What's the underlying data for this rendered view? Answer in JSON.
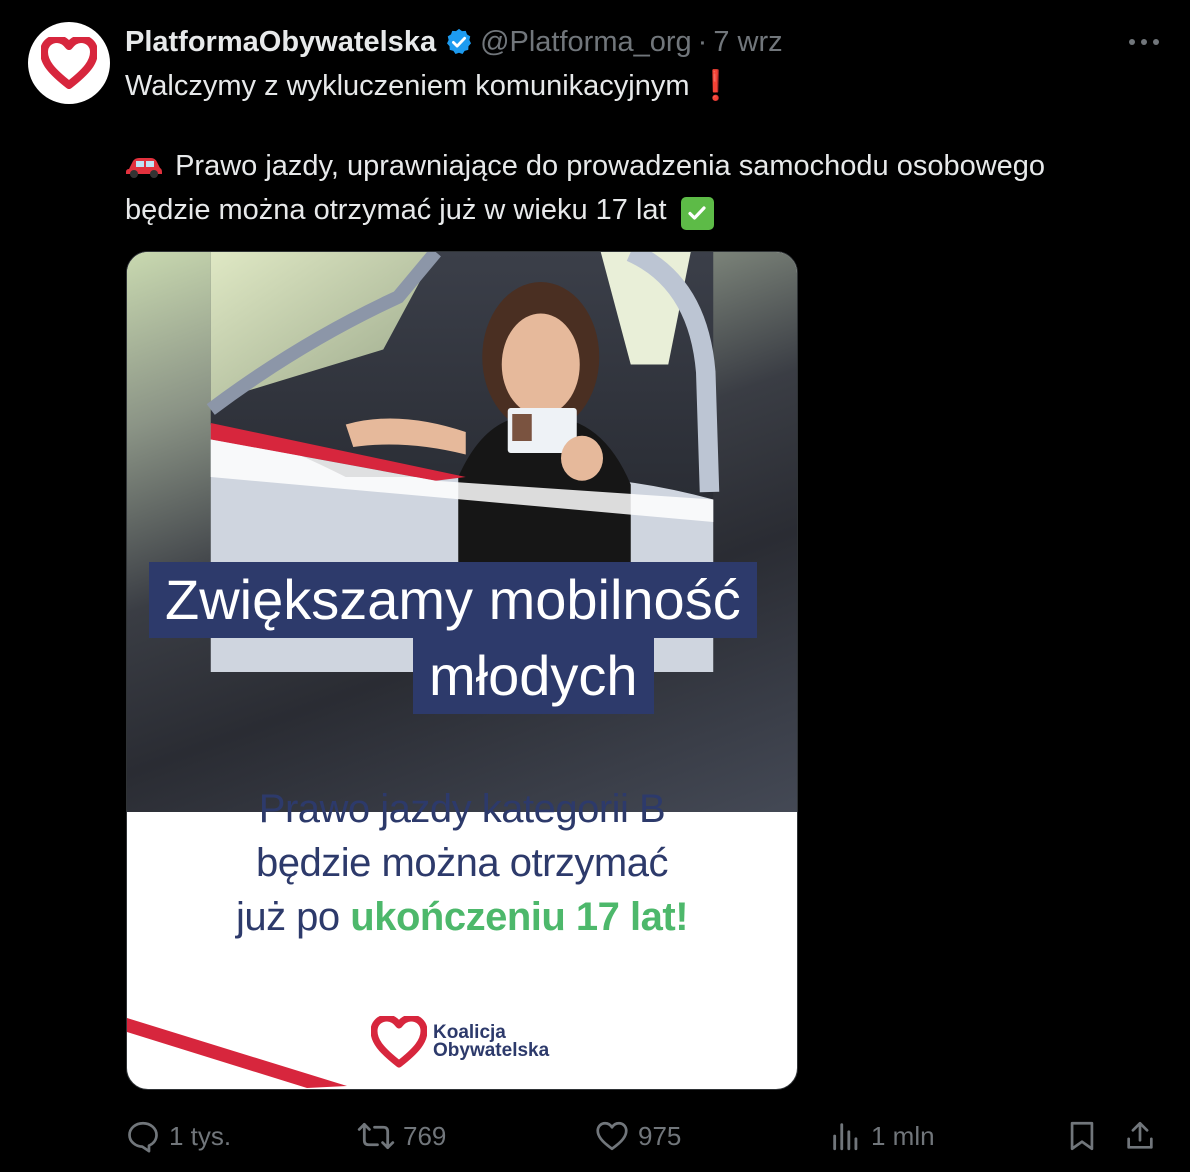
{
  "author": {
    "display_name": "PlatformaObywatelska",
    "handle": "@Platforma_org",
    "separator": "·",
    "date": "7 wrz",
    "avatar_icon": "heart-logo-icon",
    "verified_icon": "verified-badge-icon"
  },
  "more_icon": "more-horizontal-icon",
  "tweet": {
    "line1": "Walczymy z wykluczeniem komunikacyjnym",
    "line1_emoji": "❗",
    "line2_emoji": "🚗",
    "line2": "Prawo jazdy, uprawniające do prowadzenia samochodu osobowego",
    "line3": "będzie można otrzymać już w wieku 17 lat",
    "line3_emoji": "✅"
  },
  "media": {
    "headline_line1": "Zwiększamy mobilność",
    "headline_line2": "młodych",
    "sub_line1": "Prawo jazdy kategorii B",
    "sub_line2": "będzie można otrzymać",
    "sub_line3_prefix": "już po ",
    "sub_line3_highlight": "ukończeniu 17 lat!",
    "logo_line1": "Koalicja",
    "logo_line2": "Obywatelska",
    "colors": {
      "navy": "#2d3a6b",
      "green": "#4db86b",
      "red": "#d7263d"
    }
  },
  "actions": {
    "replies": "1 tys.",
    "retweets": "769",
    "likes": "975",
    "views": "1 mln"
  }
}
